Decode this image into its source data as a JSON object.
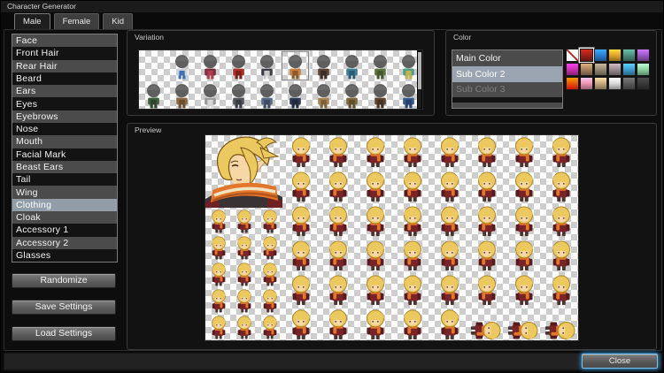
{
  "window": {
    "title": "Character Generator"
  },
  "tabs": [
    {
      "label": "Male",
      "active": true
    },
    {
      "label": "Female",
      "active": false
    },
    {
      "label": "Kid",
      "active": false
    }
  ],
  "sidebar": {
    "items": [
      {
        "label": "Face",
        "selected": false
      },
      {
        "label": "Front Hair",
        "selected": false
      },
      {
        "label": "Rear Hair",
        "selected": false
      },
      {
        "label": "Beard",
        "selected": false
      },
      {
        "label": "Ears",
        "selected": false
      },
      {
        "label": "Eyes",
        "selected": false
      },
      {
        "label": "Eyebrows",
        "selected": false
      },
      {
        "label": "Nose",
        "selected": false
      },
      {
        "label": "Mouth",
        "selected": false
      },
      {
        "label": "Facial Mark",
        "selected": false
      },
      {
        "label": "Beast Ears",
        "selected": false
      },
      {
        "label": "Tail",
        "selected": false
      },
      {
        "label": "Wing",
        "selected": false
      },
      {
        "label": "Clothing",
        "selected": true
      },
      {
        "label": "Cloak",
        "selected": false
      },
      {
        "label": "Accessory 1",
        "selected": false
      },
      {
        "label": "Accessory 2",
        "selected": false
      },
      {
        "label": "Glasses",
        "selected": false
      }
    ],
    "buttons": {
      "randomize": "Randomize",
      "save": "Save Settings",
      "load": "Load Settings"
    }
  },
  "variation": {
    "label": "Variation",
    "selected": {
      "row": 0,
      "col": 5
    },
    "rows": [
      [
        null,
        [
          "#cfd2d8",
          "#3f6fb8"
        ],
        [
          "#7c2f3f",
          "#b23a4a"
        ],
        [
          "#b03028",
          "#7c1f1a"
        ],
        [
          "#3c3c44",
          "#c8c8c8"
        ],
        [
          "#c98141",
          "#8a5a2a"
        ],
        [
          "#5a4436",
          "#3a2c22"
        ],
        [
          "#3e7f96",
          "#2c5a74"
        ],
        [
          "#5f7342",
          "#46582e"
        ],
        [
          "#4f9e8a",
          "#c3b24a"
        ]
      ],
      [
        [
          "#3f5f3f",
          "#2c452c"
        ],
        [
          "#8a6a42",
          "#6a4e2e"
        ],
        [
          "#9a9a9a",
          "#d8d8d8"
        ],
        [
          "#55555f",
          "#3a3a44"
        ],
        [
          "#5a6a85",
          "#3e4a63"
        ],
        [
          "#2e3a52",
          "#1f2a3d"
        ],
        [
          "#a5854f",
          "#7c6138"
        ],
        [
          "#7c6a3f",
          "#5d4f2c"
        ],
        [
          "#5f4632",
          "#44311f"
        ],
        [
          "#3a5a8f",
          "#28406b"
        ]
      ]
    ]
  },
  "color": {
    "label": "Color",
    "options": [
      {
        "label": "Main Color",
        "state": "normal"
      },
      {
        "label": "Sub Color 2",
        "state": "selected"
      },
      {
        "label": "Sub Color 3",
        "state": "disabled"
      },
      {
        "label": "",
        "state": "empty"
      },
      {
        "label": "",
        "state": "empty"
      }
    ],
    "palette": [
      {
        "type": "none"
      },
      {
        "type": "color",
        "value": "#a02018",
        "selected": true
      },
      {
        "type": "color",
        "value": "#2b7fd4"
      },
      {
        "type": "color",
        "value": "#e0a52a"
      },
      {
        "type": "color",
        "value": "#4e8e7f"
      },
      {
        "type": "color",
        "value": "#9b59c8"
      },
      {
        "type": "color",
        "value": "#cf2fb3"
      },
      {
        "type": "color",
        "value": "#a8835f"
      },
      {
        "type": "color",
        "value": "#968b76"
      },
      {
        "type": "color",
        "value": "#9b8d94"
      },
      {
        "type": "color",
        "value": "#3e9fd0"
      },
      {
        "type": "color",
        "value": "#8fd3a0"
      },
      {
        "type": "gradient",
        "from": "#ff9a00",
        "to": "#cf1408"
      },
      {
        "type": "color",
        "value": "#ef93b1"
      },
      {
        "type": "color",
        "value": "#c5a87b"
      },
      {
        "type": "color",
        "value": "#d9d9d9"
      },
      {
        "type": "color",
        "value": "#5a5a5a"
      },
      {
        "type": "color",
        "value": "#383838"
      }
    ]
  },
  "preview": {
    "label": "Preview",
    "character": {
      "hair": "#ecc95e",
      "hair_shade": "#a8801f",
      "skin": "#f6d7a5",
      "outfit": "#7b2427",
      "outfit_dark": "#571a1d",
      "scarf": "#e2762a",
      "scarf_stripe": "#f3e3c0",
      "boots": "#4a3430"
    },
    "walk_grid": {
      "cols": 3,
      "rows": 5
    },
    "pose_grid": {
      "cols": 8,
      "rows": 6
    }
  },
  "footer": {
    "close_label": "Close"
  }
}
